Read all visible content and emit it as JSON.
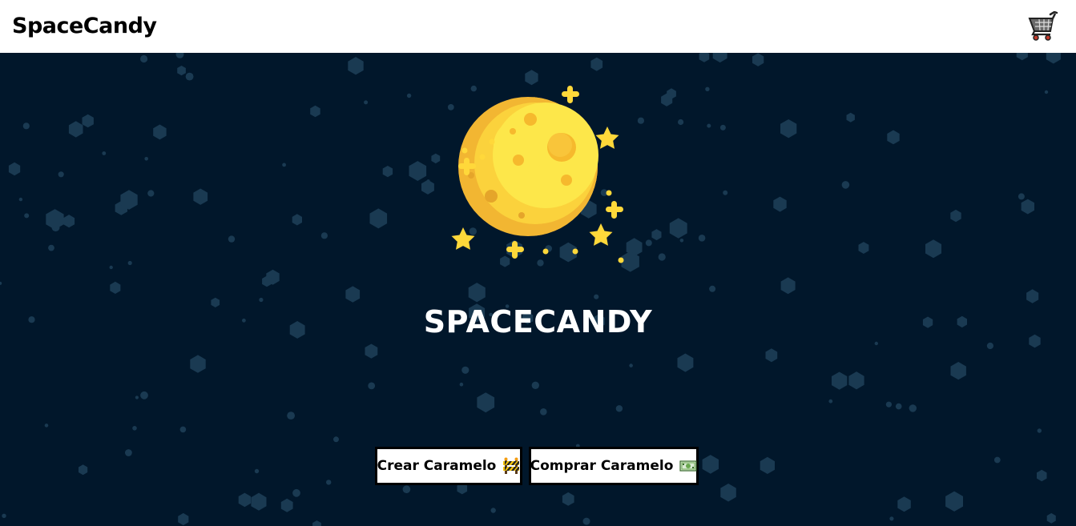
{
  "navbar": {
    "brand": "SpaceCandy",
    "cart_icon": "shopping-cart-icon"
  },
  "hero": {
    "image": "moon-with-stars-icon",
    "title": "SPACECANDY"
  },
  "actions": {
    "create_label": "Crear Caramelo",
    "create_icon": "construction-barrier-icon",
    "buy_label": "Comprar Caramelo",
    "buy_icon": "banknote-icon"
  },
  "colors": {
    "navbar_bg": "#ffffff",
    "space_bg": "#01172b",
    "hexagon": "#1a3a52",
    "moon": "#f9c52c",
    "star": "#ffd83a",
    "title": "#ffffff"
  }
}
